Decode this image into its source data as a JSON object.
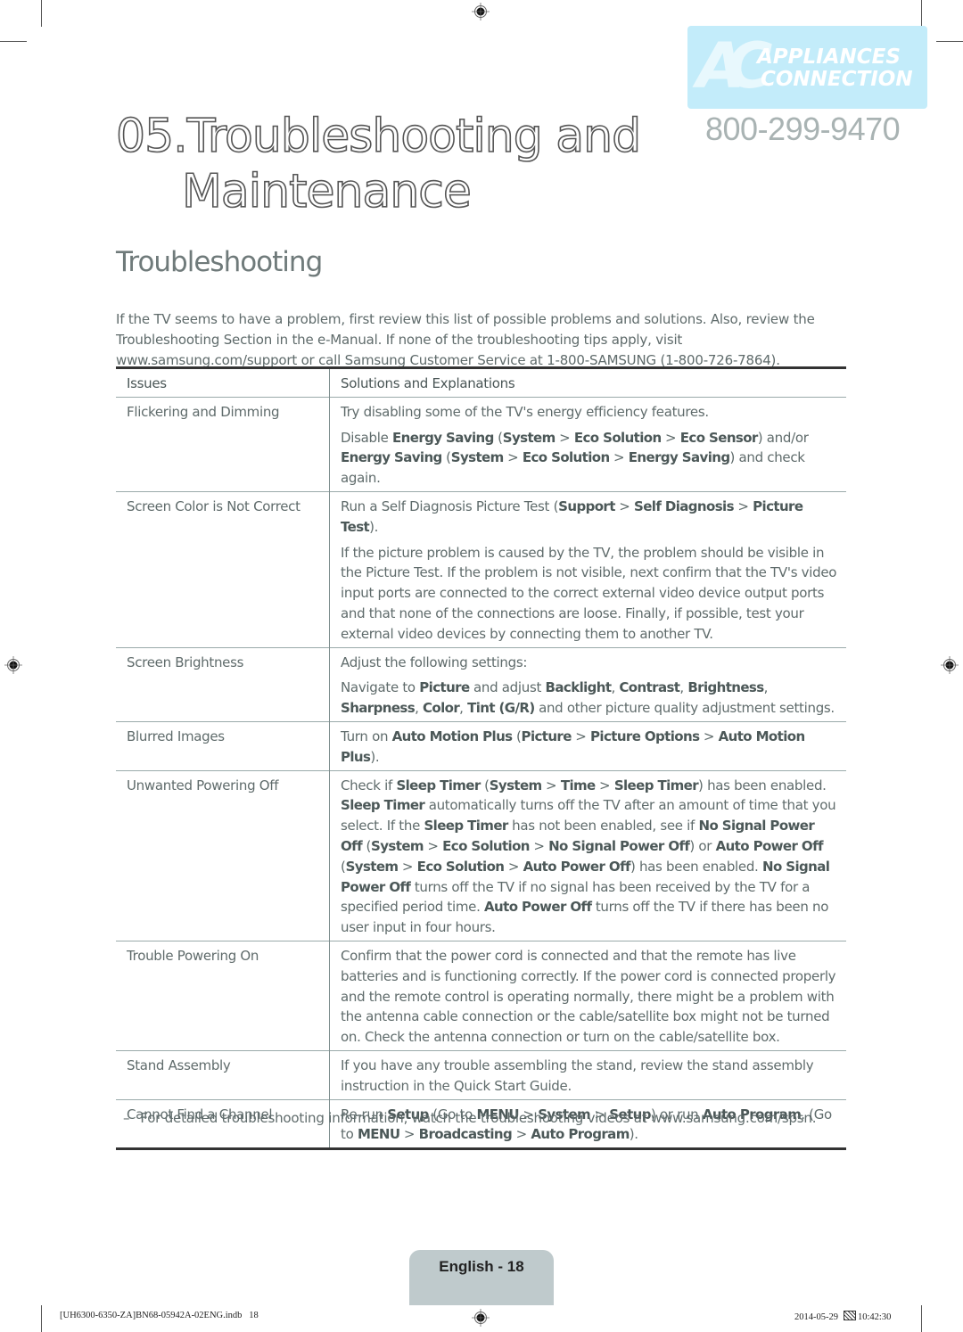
{
  "header": {
    "chapter_line1": "05.Troubleshooting and",
    "chapter_line2": "Maintenance",
    "section_title": "Troubleshooting"
  },
  "watermark": {
    "logo_initials": "AC",
    "logo_line1": "APPLIANCES",
    "logo_line2": "CONNECTION",
    "phone": "800-299-9470",
    "brand_color": "#c3ecfa"
  },
  "intro": "If the TV seems to have a problem, first review this list of possible problems and solutions. Also, review the Troubleshooting Section in the e-Manual. If none of the troubleshooting tips apply, visit www.samsung.com/support or call Samsung Customer Service at 1-800-SAMSUNG (1-800-726-7864).",
  "table": {
    "headers": [
      "Issues",
      "Solutions and Explanations"
    ],
    "rows": [
      {
        "issue": "Flickering and Dimming",
        "solutions": [
          [
            {
              "t": "Try disabling some of the TV's energy efficiency features."
            }
          ],
          [
            {
              "t": "Disable "
            },
            {
              "t": "Energy Saving",
              "b": true
            },
            {
              "t": " ("
            },
            {
              "t": "System",
              "b": true
            },
            {
              "t": " > "
            },
            {
              "t": "Eco Solution",
              "b": true
            },
            {
              "t": " > "
            },
            {
              "t": "Eco Sensor",
              "b": true
            },
            {
              "t": ") and/or "
            },
            {
              "t": "Energy Saving",
              "b": true
            },
            {
              "t": " ("
            },
            {
              "t": "System",
              "b": true
            },
            {
              "t": " > "
            },
            {
              "t": "Eco Solution",
              "b": true
            },
            {
              "t": " > "
            },
            {
              "t": "Energy Saving",
              "b": true
            },
            {
              "t": ") and check again."
            }
          ]
        ]
      },
      {
        "issue": "Screen Color is Not Correct",
        "solutions": [
          [
            {
              "t": "Run a Self Diagnosis Picture Test ("
            },
            {
              "t": "Support",
              "b": true
            },
            {
              "t": " > "
            },
            {
              "t": "Self Diagnosis",
              "b": true
            },
            {
              "t": " > "
            },
            {
              "t": "Picture Test",
              "b": true
            },
            {
              "t": ")."
            }
          ],
          [
            {
              "t": "If the picture problem is caused by the TV, the problem should be visible in the Picture Test. If the problem is not visible, next confirm that the TV's video input ports are connected to the correct external video device output ports and that none of the connections are loose. Finally, if possible, test your external video devices by connecting them to another TV."
            }
          ]
        ]
      },
      {
        "issue": "Screen Brightness",
        "solutions": [
          [
            {
              "t": "Adjust the following settings:"
            }
          ],
          [
            {
              "t": "Navigate to "
            },
            {
              "t": "Picture",
              "b": true
            },
            {
              "t": " and adjust "
            },
            {
              "t": "Backlight",
              "b": true
            },
            {
              "t": ", "
            },
            {
              "t": "Contrast",
              "b": true
            },
            {
              "t": ", "
            },
            {
              "t": "Brightness",
              "b": true
            },
            {
              "t": ", "
            },
            {
              "t": "Sharpness",
              "b": true
            },
            {
              "t": ", "
            },
            {
              "t": "Color",
              "b": true
            },
            {
              "t": ", "
            },
            {
              "t": "Tint (G/R)",
              "b": true
            },
            {
              "t": " and other picture quality adjustment settings."
            }
          ]
        ]
      },
      {
        "issue": "Blurred Images",
        "solutions": [
          [
            {
              "t": "Turn on "
            },
            {
              "t": "Auto Motion Plus",
              "b": true
            },
            {
              "t": " ("
            },
            {
              "t": "Picture",
              "b": true
            },
            {
              "t": " > "
            },
            {
              "t": "Picture Options",
              "b": true
            },
            {
              "t": " > "
            },
            {
              "t": "Auto Motion Plus",
              "b": true
            },
            {
              "t": ")."
            }
          ]
        ]
      },
      {
        "issue": "Unwanted Powering Off",
        "solutions": [
          [
            {
              "t": "Check if "
            },
            {
              "t": "Sleep Timer",
              "b": true
            },
            {
              "t": " ("
            },
            {
              "t": "System",
              "b": true
            },
            {
              "t": " > "
            },
            {
              "t": "Time",
              "b": true
            },
            {
              "t": " > "
            },
            {
              "t": "Sleep Timer",
              "b": true
            },
            {
              "t": ") has been enabled. "
            },
            {
              "t": "Sleep Timer",
              "b": true
            },
            {
              "t": " automatically turns off the TV after an amount of time that you select. If the "
            },
            {
              "t": "Sleep Timer",
              "b": true
            },
            {
              "t": " has not been enabled, see if "
            },
            {
              "t": "No Signal Power Off",
              "b": true
            },
            {
              "t": " ("
            },
            {
              "t": "System",
              "b": true
            },
            {
              "t": " > "
            },
            {
              "t": "Eco Solution",
              "b": true
            },
            {
              "t": " > "
            },
            {
              "t": "No Signal Power Off",
              "b": true
            },
            {
              "t": ") or "
            },
            {
              "t": "Auto Power Off",
              "b": true
            },
            {
              "t": " ("
            },
            {
              "t": "System",
              "b": true
            },
            {
              "t": " > "
            },
            {
              "t": "Eco Solution",
              "b": true
            },
            {
              "t": " > "
            },
            {
              "t": "Auto Power Off",
              "b": true
            },
            {
              "t": ") has been enabled. "
            },
            {
              "t": "No Signal Power Off",
              "b": true
            },
            {
              "t": " turns off the TV if no signal has been received by the TV for a specified period time. "
            },
            {
              "t": "Auto Power Off",
              "b": true
            },
            {
              "t": " turns off the TV if there has been no user input in four hours."
            }
          ]
        ]
      },
      {
        "issue": "Trouble Powering On",
        "solutions": [
          [
            {
              "t": "Confirm that the power cord is connected and that the remote has live batteries and is functioning correctly. If the power cord is connected properly and the remote control is operating normally, there might be a problem with the antenna cable connection or the cable/satellite box might not be turned on. Check the antenna connection or turn on the cable/satellite box."
            }
          ]
        ]
      },
      {
        "issue": "Stand Assembly",
        "solutions": [
          [
            {
              "t": "If you have any trouble assembling the stand, review the stand assembly instruction in the Quick Start Guide."
            }
          ]
        ]
      },
      {
        "issue": "Cannot Find a Channel",
        "solutions": [
          [
            {
              "t": "Re-run "
            },
            {
              "t": "Setup",
              "b": true
            },
            {
              "t": " (Go to "
            },
            {
              "t": "MENU",
              "b": true
            },
            {
              "t": " > "
            },
            {
              "t": "System",
              "b": true
            },
            {
              "t": " > "
            },
            {
              "t": "Setup",
              "b": true
            },
            {
              "t": ") or run "
            },
            {
              "t": "Auto Program",
              "b": true
            },
            {
              "t": ". (Go to "
            },
            {
              "t": "MENU",
              "b": true
            },
            {
              "t": " > "
            },
            {
              "t": "Broadcasting",
              "b": true
            },
            {
              "t": " > "
            },
            {
              "t": "Auto Program",
              "b": true
            },
            {
              "t": ")."
            }
          ]
        ]
      }
    ]
  },
  "note": {
    "dash": "–",
    "text": "For detailed troubleshooting information, watch the troubleshooting videos at www.samsung.com/spsn."
  },
  "page_label": "English - 18",
  "footer": {
    "file": "[UH6300-6350-ZA]BN68-05942A-02ENG.indb   18",
    "date": "2014-05-29",
    "time": "10:42:30"
  }
}
